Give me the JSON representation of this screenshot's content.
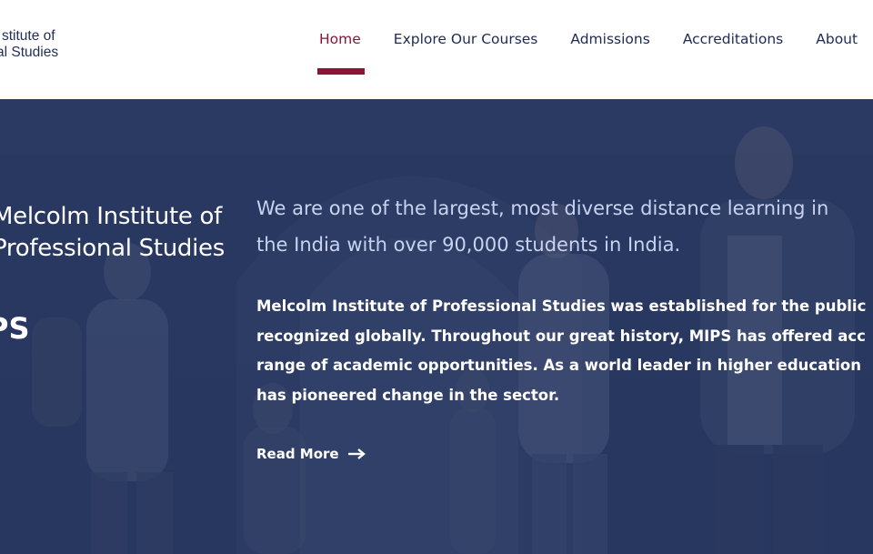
{
  "header": {
    "logo_line1": "stitute of",
    "logo_line2": "al Studies",
    "nav": [
      {
        "label": "Home",
        "active": true
      },
      {
        "label": "Explore Our Courses",
        "active": false
      },
      {
        "label": "Admissions",
        "active": false
      },
      {
        "label": "Accreditations",
        "active": false
      },
      {
        "label": "About",
        "active": false
      }
    ]
  },
  "hero": {
    "side_title_line1": "Melcolm Institute of",
    "side_title_line2": "Professional Studies",
    "side_abbr": "PS",
    "lead_line1": "We are one of the largest, most diverse distance learning in",
    "lead_line2": "the India with over 90,000 students in India.",
    "body_line1": "Melcolm Institute of Professional Studies was established for the public",
    "body_line2": "recognized globally. Throughout our great history, MIPS has offered acc",
    "body_line3": "range of academic opportunities. As a world leader in higher education",
    "body_line4": "has pioneered change in the sector.",
    "read_more": "Read More"
  },
  "colors": {
    "accent": "#8a1538",
    "nav_text": "#1e2a52",
    "hero_overlay": "#2c3b61",
    "lead_text": "#c8d3f2"
  }
}
